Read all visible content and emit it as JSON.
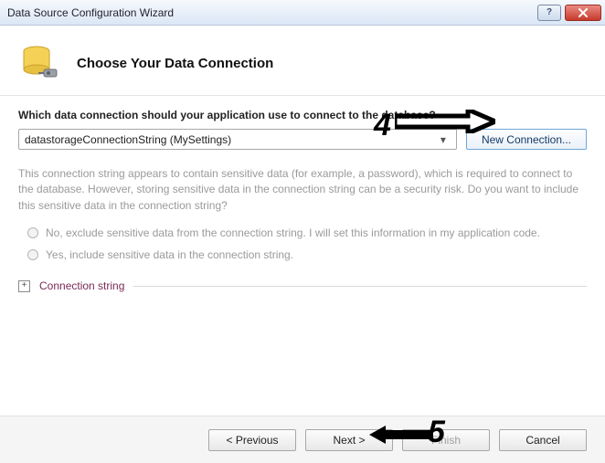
{
  "window": {
    "title": "Data Source Configuration Wizard"
  },
  "header": {
    "heading": "Choose Your Data Connection"
  },
  "content": {
    "prompt": "Which data connection should your application use to connect to the database?",
    "selected_connection": "datastorageConnectionString (MySettings)",
    "new_connection_label": "New Connection...",
    "sensitive_info": "This connection string appears to contain sensitive data (for example, a password), which is required to connect to the database. However, storing sensitive data in the connection string can be a security risk. Do you want to include this sensitive data in the connection string?",
    "radio_exclude": "No, exclude sensitive data from the connection string. I will set this information in my application code.",
    "radio_include": "Yes, include sensitive data in the connection string.",
    "expander_label": "Connection string"
  },
  "footer": {
    "previous": "< Previous",
    "next": "Next >",
    "finish": "Finish",
    "cancel": "Cancel"
  },
  "annotations": {
    "num4": "4",
    "num5": "5"
  }
}
